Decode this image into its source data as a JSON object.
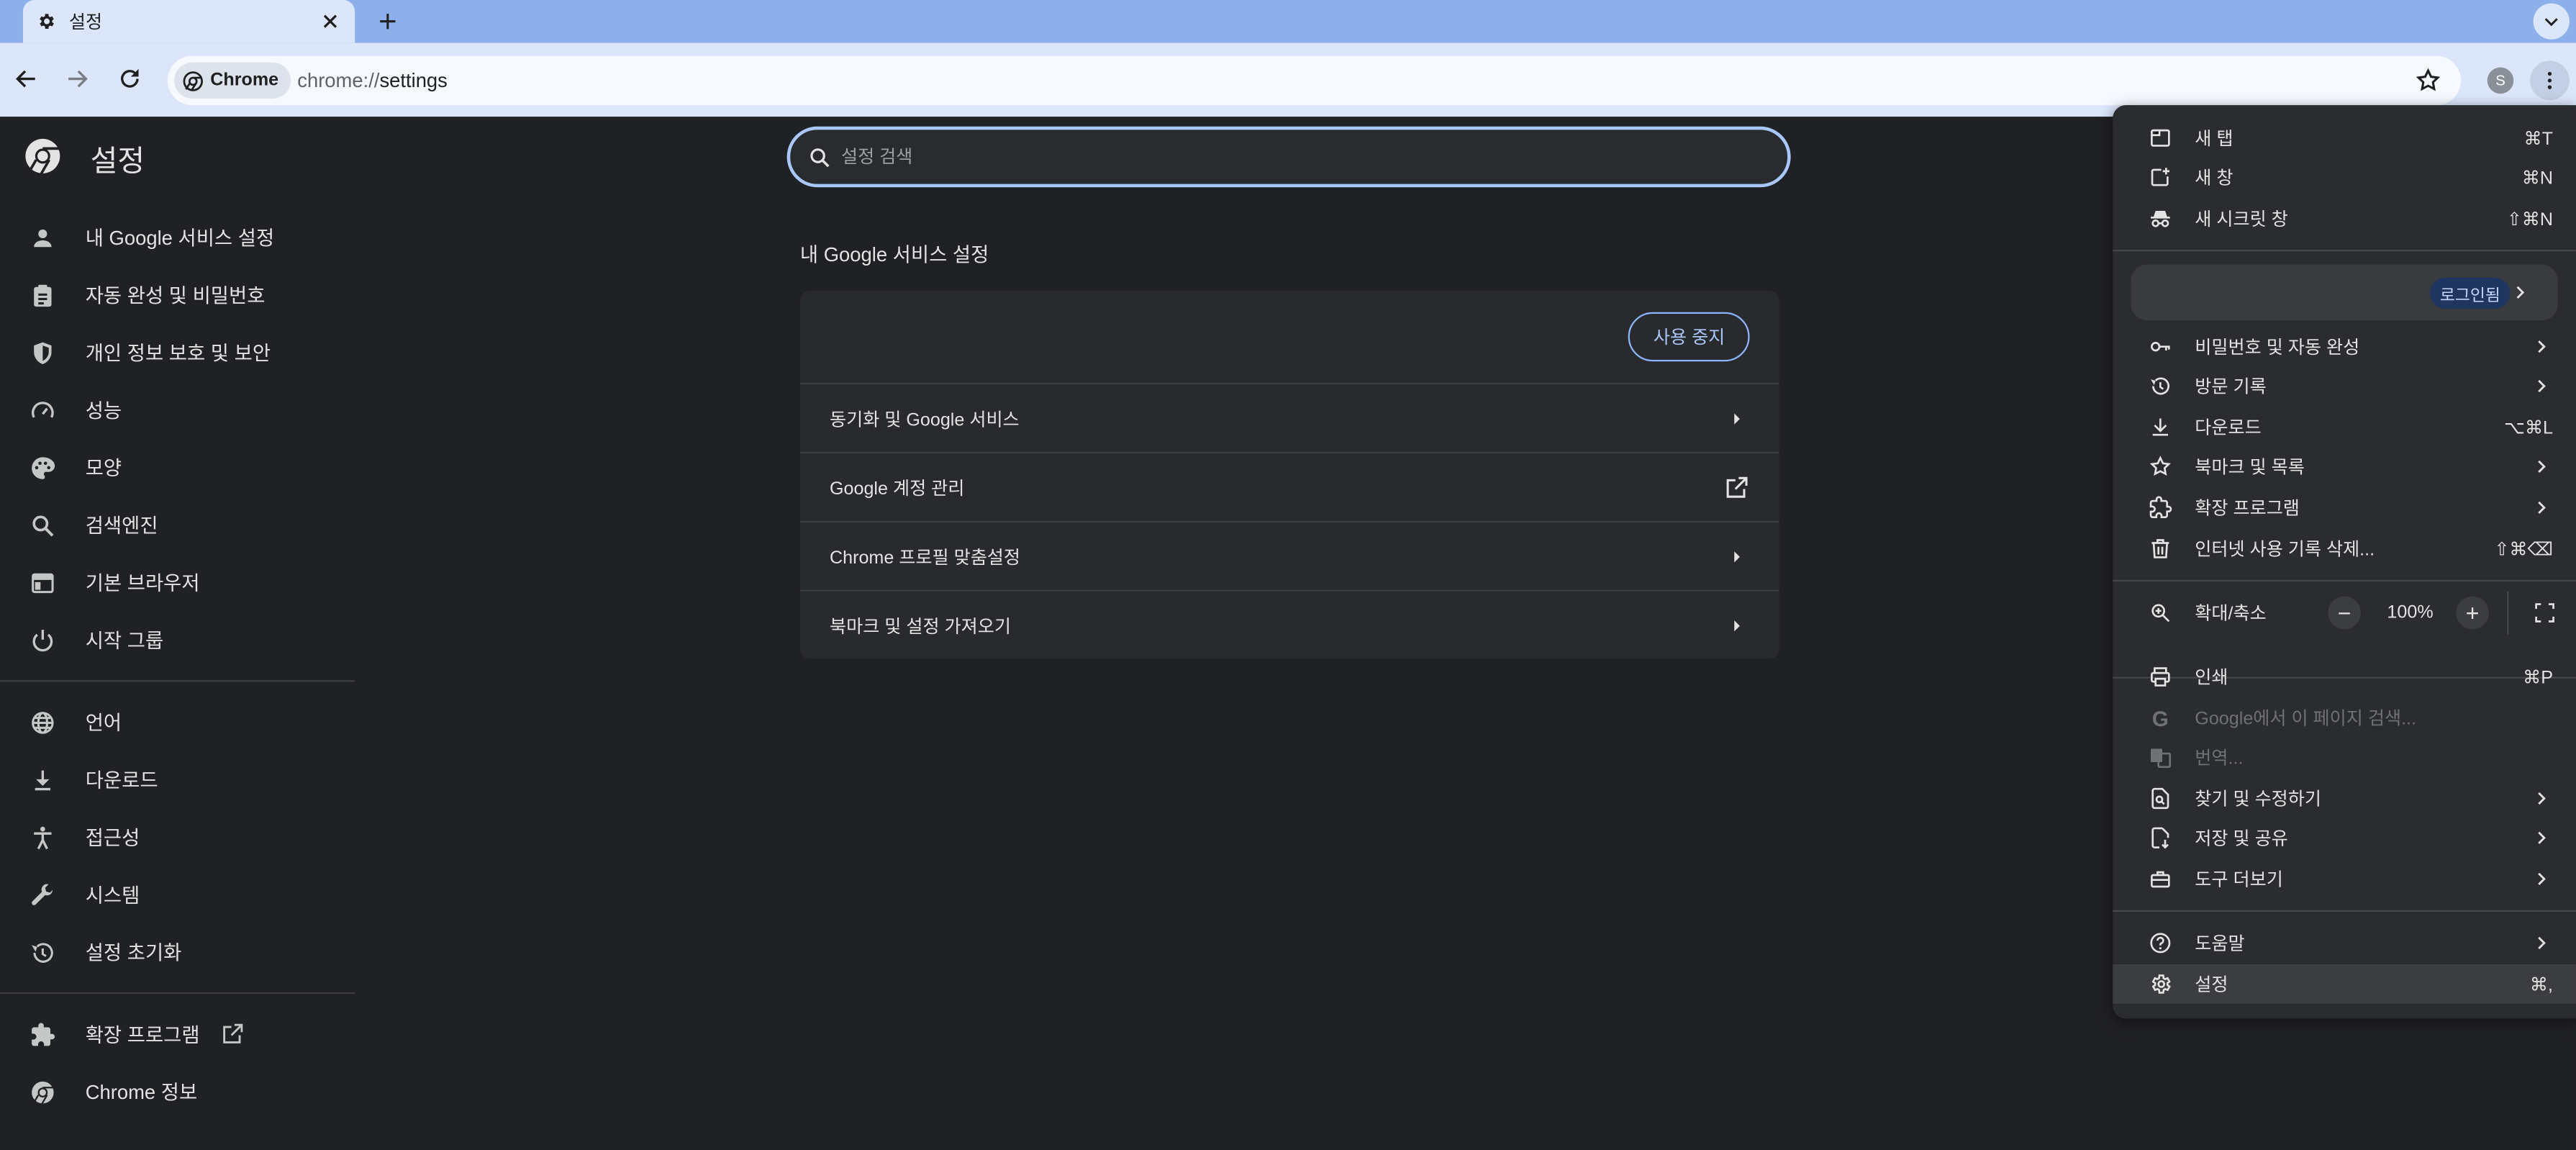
{
  "tab": {
    "title": "설정"
  },
  "omnibox": {
    "chip_label": "Chrome",
    "url_scheme": "chrome://",
    "url_path": "settings"
  },
  "profile": {
    "avatar_initial": "S"
  },
  "sidebar": {
    "title": "설정",
    "items": [
      {
        "label": "내 Google 서비스 설정",
        "icon": "person-icon"
      },
      {
        "label": "자동 완성 및 비밀번호",
        "icon": "clipboard-icon"
      },
      {
        "label": "개인 정보 보호 및 보안",
        "icon": "shield-icon"
      },
      {
        "label": "성능",
        "icon": "speedometer-icon"
      },
      {
        "label": "모양",
        "icon": "palette-icon"
      },
      {
        "label": "검색엔진",
        "icon": "search-icon"
      },
      {
        "label": "기본 브라우저",
        "icon": "browser-window-icon"
      },
      {
        "label": "시작 그룹",
        "icon": "power-icon"
      },
      {
        "label": "언어",
        "icon": "globe-icon"
      },
      {
        "label": "다운로드",
        "icon": "download-icon"
      },
      {
        "label": "접근성",
        "icon": "accessibility-icon"
      },
      {
        "label": "시스템",
        "icon": "wrench-icon"
      },
      {
        "label": "설정 초기화",
        "icon": "history-icon"
      },
      {
        "label": "확장 프로그램",
        "icon": "puzzle-icon"
      },
      {
        "label": "Chrome 정보",
        "icon": "chrome-logo-icon"
      }
    ]
  },
  "search": {
    "placeholder": "설정 검색"
  },
  "main": {
    "section_title": "내 Google 서비스 설정",
    "stop_button": "사용 중지",
    "rows": [
      {
        "label": "동기화 및 Google 서비스"
      },
      {
        "label": "Google 계정 관리"
      },
      {
        "label": "Chrome 프로필 맞춤설정"
      },
      {
        "label": "북마크 및 설정 가져오기"
      }
    ]
  },
  "menu": {
    "new_tab": {
      "label": "새 탭",
      "shortcut": "⌘T"
    },
    "new_window": {
      "label": "새 창",
      "shortcut": "⌘N"
    },
    "incognito": {
      "label": "새 시크릿 창",
      "shortcut": "⇧⌘N"
    },
    "signin_badge": "로그인됨",
    "passwords": {
      "label": "비밀번호 및 자동 완성"
    },
    "history": {
      "label": "방문 기록"
    },
    "downloads": {
      "label": "다운로드",
      "shortcut": "⌥⌘L"
    },
    "bookmarks": {
      "label": "북마크 및 목록"
    },
    "extensions": {
      "label": "확장 프로그램"
    },
    "clear_data": {
      "label": "인터넷 사용 기록 삭제...",
      "shortcut": "⇧⌘⌫"
    },
    "zoom": {
      "label": "확대/축소",
      "minus": "−",
      "value": "100%",
      "plus": "+"
    },
    "print": {
      "label": "인쇄",
      "shortcut": "⌘P"
    },
    "google_search": {
      "label": "Google에서 이 페이지 검색..."
    },
    "translate": {
      "label": "번역..."
    },
    "find_edit": {
      "label": "찾기 및 수정하기"
    },
    "save_share": {
      "label": "저장 및 공유"
    },
    "more_tools": {
      "label": "도구 더보기"
    },
    "help": {
      "label": "도움말"
    },
    "settings": {
      "label": "설정",
      "shortcut": "⌘,"
    }
  },
  "colors": {
    "accent": "#a8c7fa",
    "background": "#202124",
    "menu_bg": "#2b2c2f",
    "tabstrip": "#8eb0ea",
    "toolbar": "#dbe6fa"
  }
}
